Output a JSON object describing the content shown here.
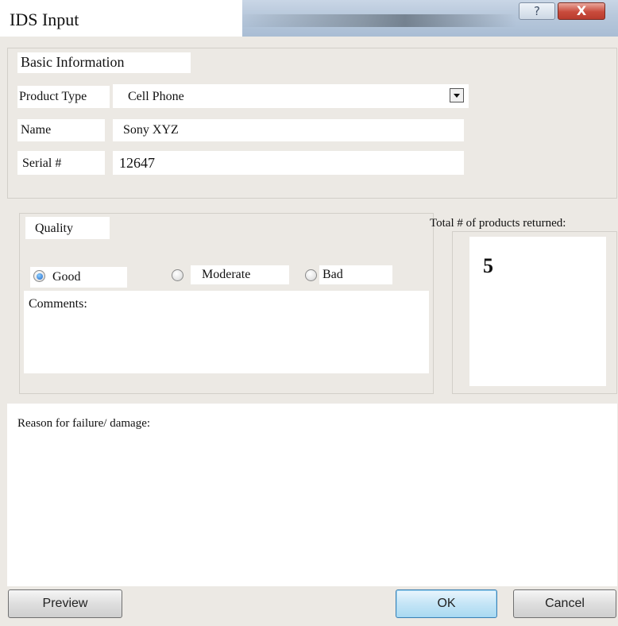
{
  "window": {
    "title": "IDS Input",
    "help_icon": "help-icon",
    "close_icon": "close-icon",
    "help_glyph": "?",
    "close_glyph": "X"
  },
  "basic_info": {
    "legend": "Basic Information",
    "product_type_label": "Product Type",
    "product_type_value": "Cell Phone",
    "name_label": "Name",
    "name_value": "Sony XYZ",
    "serial_label": "Serial #",
    "serial_value": "12647"
  },
  "quality": {
    "legend": "Quality",
    "options": [
      "Good",
      "Moderate",
      "Bad"
    ],
    "selected": "Good",
    "comments_label": "Comments:",
    "comments_value": ""
  },
  "returns": {
    "label": "Total # of products returned:",
    "count": "5"
  },
  "reason": {
    "label": "Reason for failure/ damage:",
    "value": ""
  },
  "buttons": {
    "preview": "Preview",
    "ok": "OK",
    "cancel": "Cancel"
  }
}
